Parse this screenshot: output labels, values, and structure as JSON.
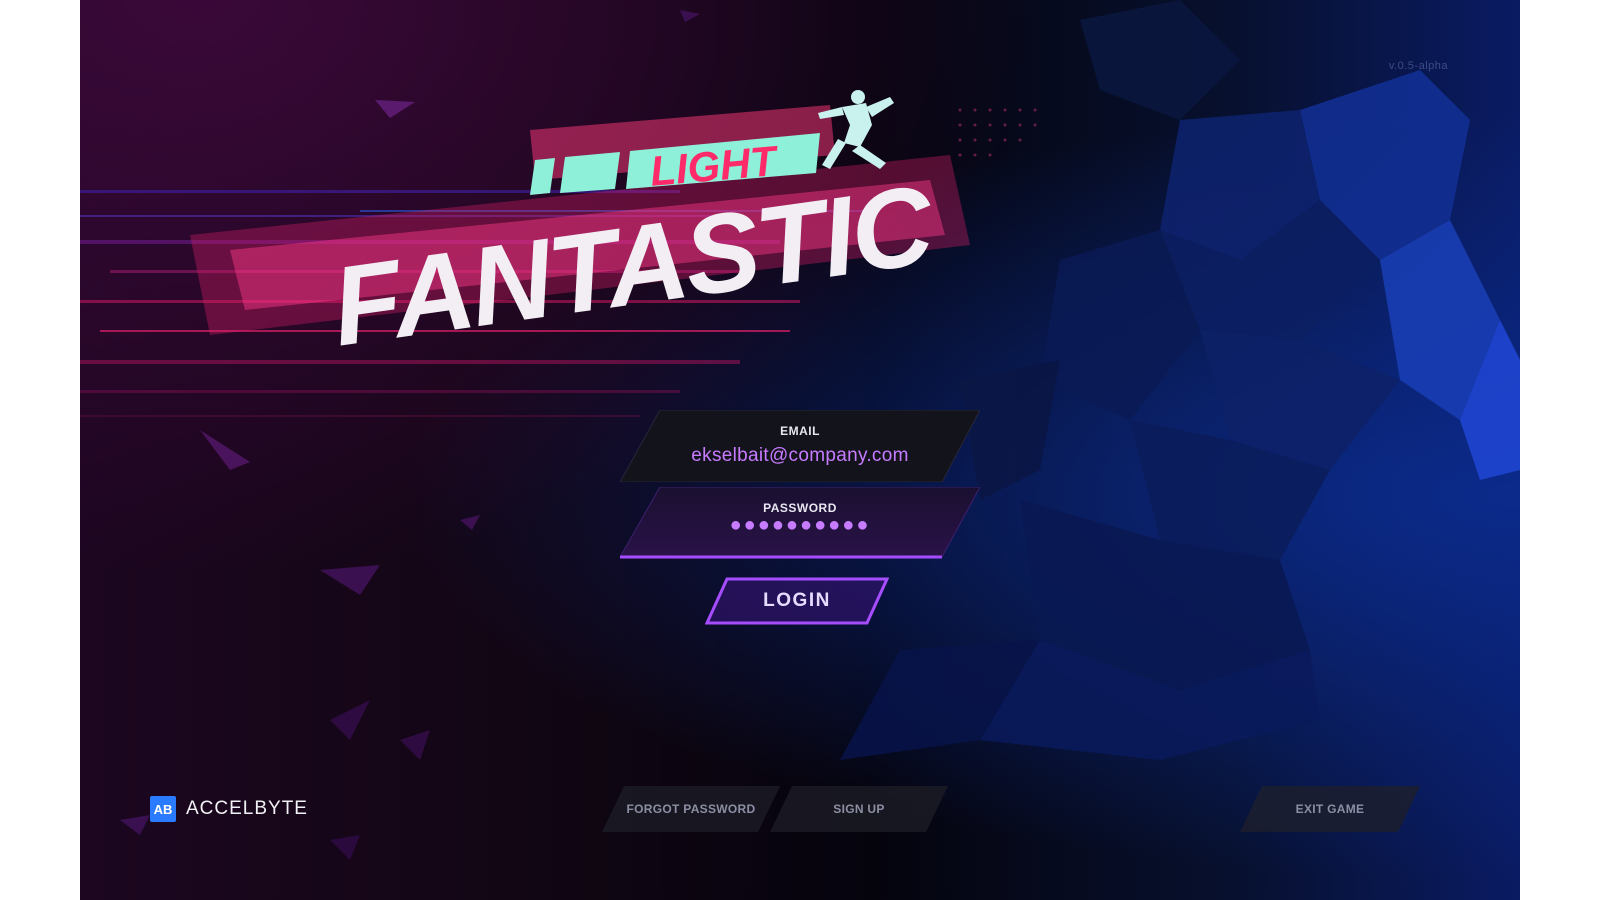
{
  "version": "v.0.5-alpha",
  "logo": {
    "word_top": "LIGHT",
    "word_main": "FANTASTIC"
  },
  "login_form": {
    "email": {
      "label": "EMAIL",
      "value": "ekselbait@company.com"
    },
    "password": {
      "label": "PASSWORD",
      "value": "●●●●●●●●●●"
    },
    "login_label": "LOGIN"
  },
  "footer": {
    "brand": {
      "mark": "AB",
      "name": "ACCELBYTE"
    },
    "forgot_password_label": "FORGOT PASSWORD",
    "sign_up_label": "SIGN UP",
    "exit_game_label": "EXIT GAME"
  },
  "colors": {
    "accent": "#c77bff",
    "field_bg": "#12121b",
    "button_border": "#9b3dff",
    "brand_blue": "#2a7bff"
  }
}
